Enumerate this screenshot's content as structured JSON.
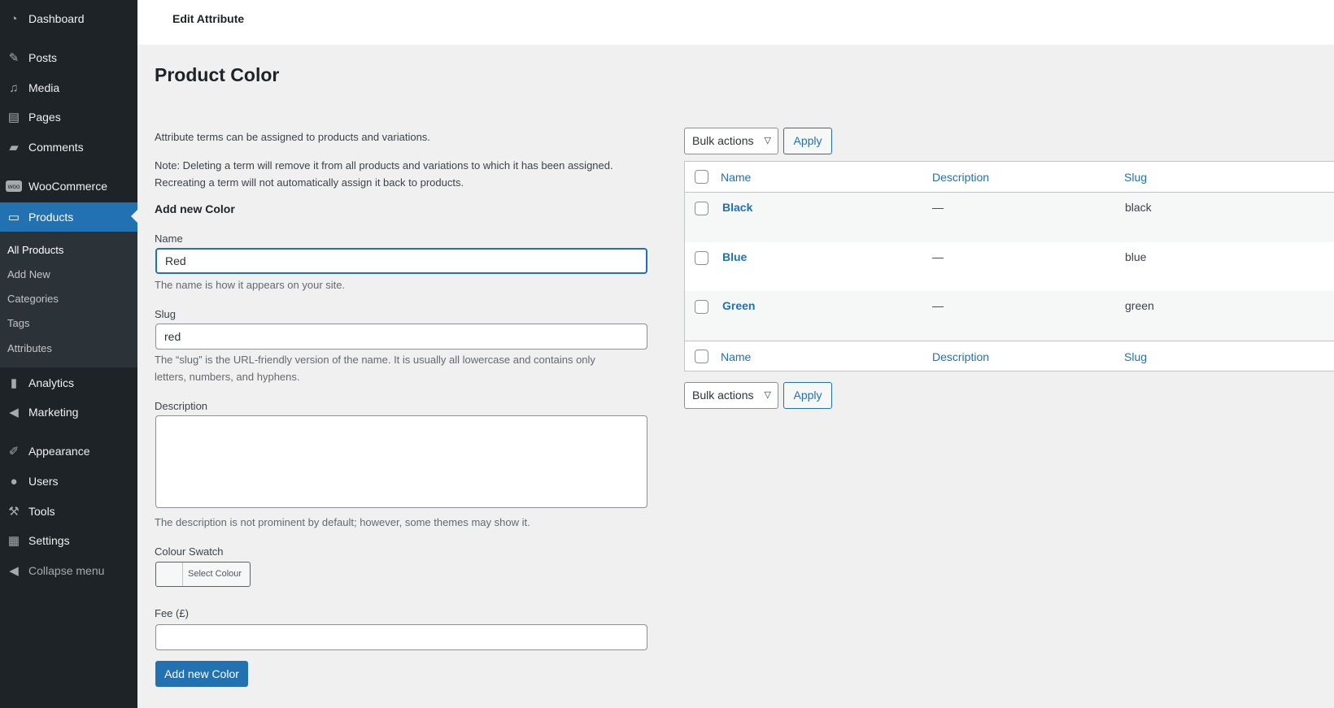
{
  "sidebar": {
    "items": [
      {
        "label": "Dashboard",
        "icon": "dashboard-icon"
      },
      {
        "label": "Posts",
        "icon": "pin-icon"
      },
      {
        "label": "Media",
        "icon": "media-icon"
      },
      {
        "label": "Pages",
        "icon": "pages-icon"
      },
      {
        "label": "Comments",
        "icon": "comment-icon"
      },
      {
        "label": "WooCommerce",
        "icon": "woo-icon"
      },
      {
        "label": "Products",
        "icon": "archive-icon",
        "active": true
      },
      {
        "label": "Analytics",
        "icon": "bar-chart-icon"
      },
      {
        "label": "Marketing",
        "icon": "megaphone-icon"
      },
      {
        "label": "Appearance",
        "icon": "brush-icon"
      },
      {
        "label": "Users",
        "icon": "user-icon"
      },
      {
        "label": "Tools",
        "icon": "wrench-icon"
      },
      {
        "label": "Settings",
        "icon": "settings-icon"
      }
    ],
    "submenu": [
      "All Products",
      "Add New",
      "Categories",
      "Tags",
      "Attributes"
    ],
    "collapse": "Collapse menu"
  },
  "header": {
    "title": "Edit Attribute"
  },
  "page": {
    "title": "Product Color"
  },
  "form": {
    "intro": "Attribute terms can be assigned to products and variations.",
    "note1": "Note: Deleting a term will remove it from all products and variations to which it has been assigned.",
    "note2": "Recreating a term will not automatically assign it back to products.",
    "heading": "Add new Color",
    "name_label": "Name",
    "name_value": "Red",
    "name_help": "The name is how it appears on your site.",
    "slug_label": "Slug",
    "slug_value": "red",
    "slug_help1": "The “slug” is the URL-friendly version of the name. It is usually all lowercase and contains only",
    "slug_help2": "letters, numbers, and hyphens.",
    "desc_label": "Description",
    "desc_value": "",
    "desc_help": "The description is not prominent by default; however, some themes may show it.",
    "swatch_label": "Colour Swatch",
    "swatch_button": "Select Colour",
    "fee_label": "Fee (£)",
    "fee_value": "",
    "submit": "Add new Color"
  },
  "table": {
    "bulk_actions": "Bulk actions",
    "apply": "Apply",
    "columns": [
      "Name",
      "Description",
      "Slug"
    ],
    "rows": [
      {
        "name": "Black",
        "description": "—",
        "slug": "black"
      },
      {
        "name": "Blue",
        "description": "—",
        "slug": "blue"
      },
      {
        "name": "Green",
        "description": "—",
        "slug": "green"
      }
    ]
  },
  "colors": {
    "accent": "#2271b1",
    "sidebar": "#1d2327"
  }
}
